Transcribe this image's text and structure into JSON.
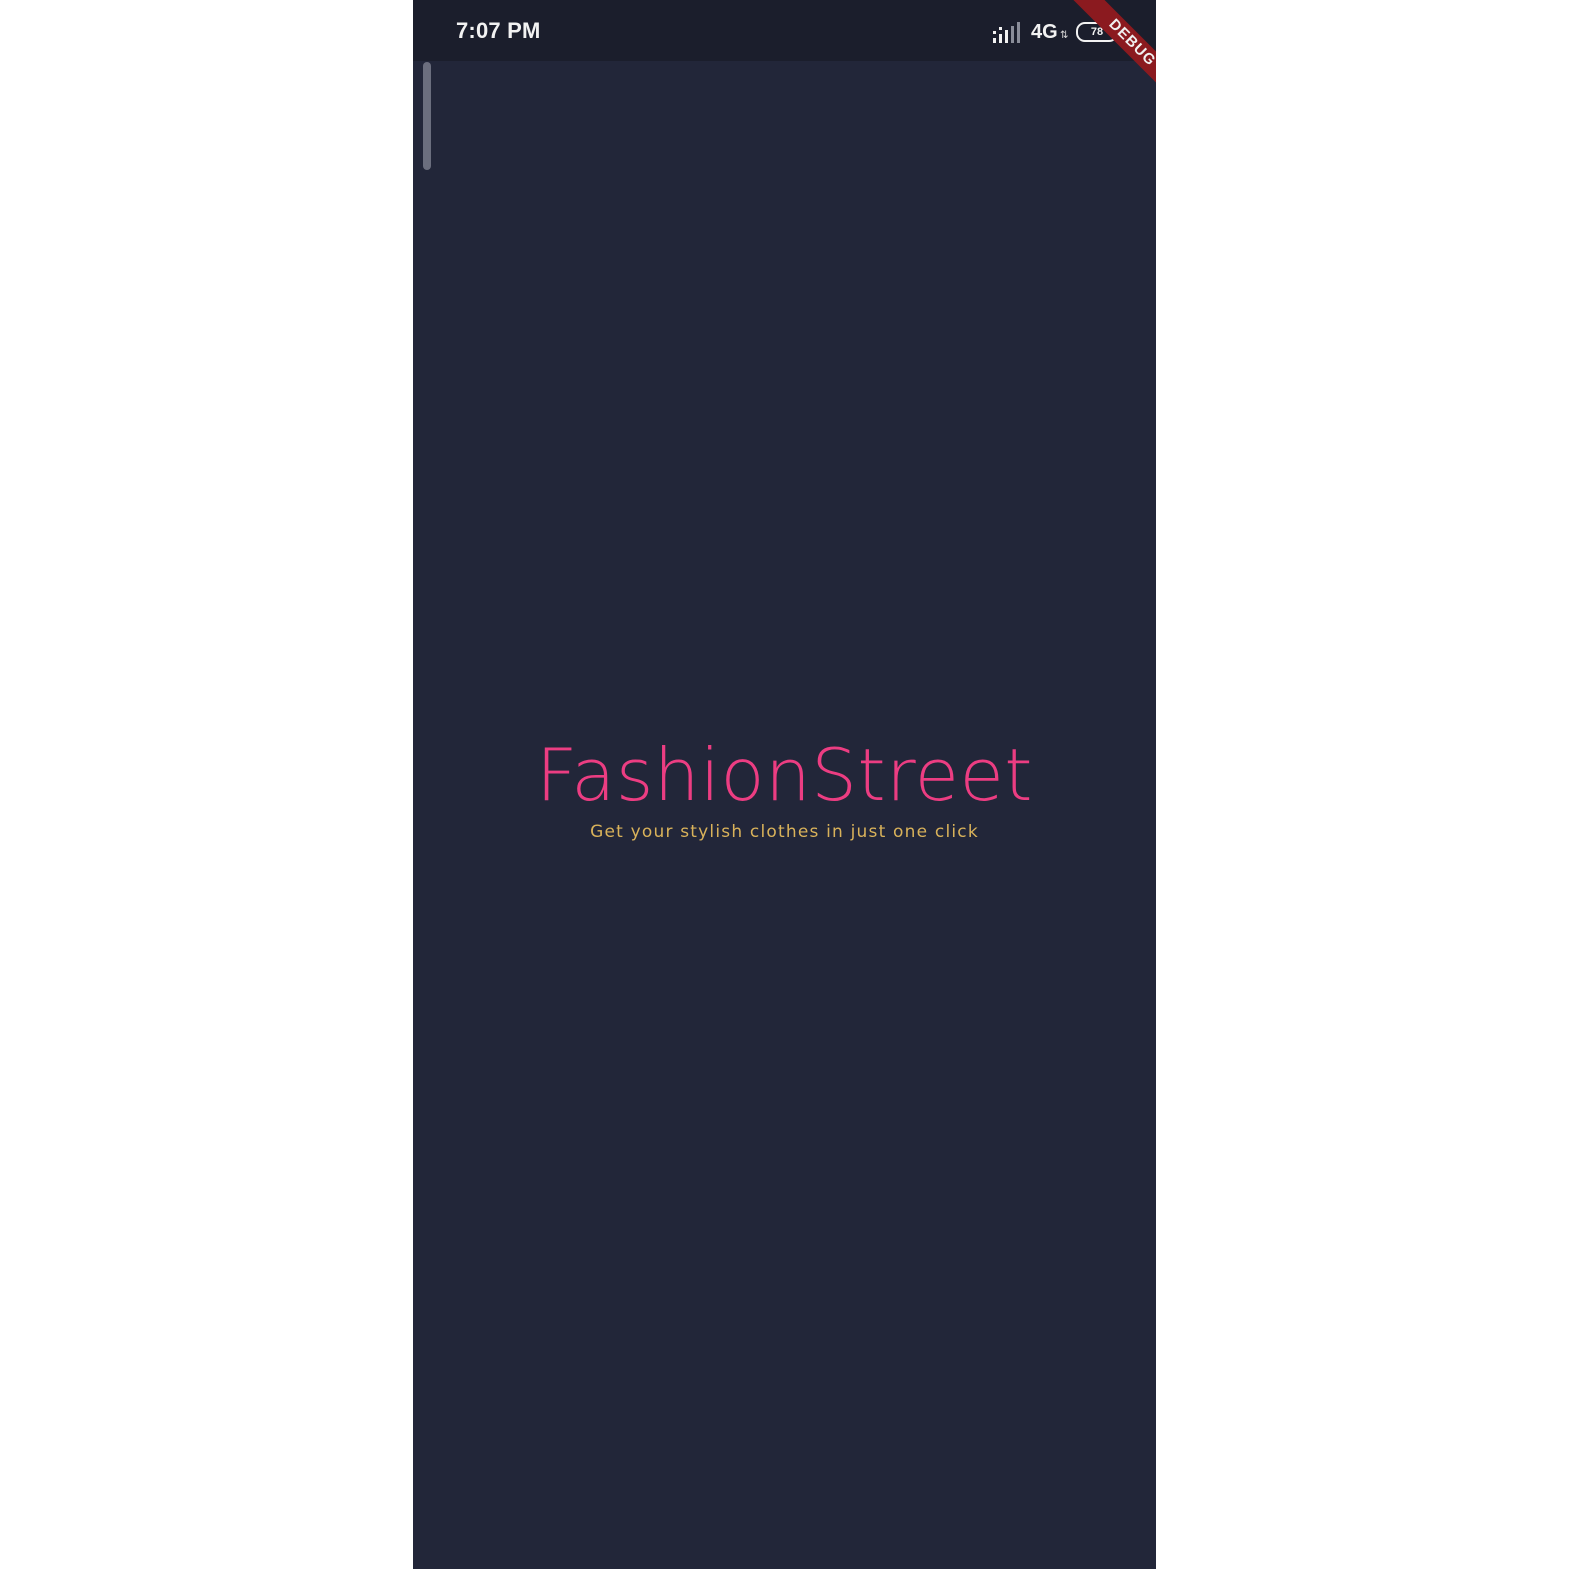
{
  "status_bar": {
    "time": "7:07 PM",
    "network_type": "4G",
    "network_activity": "⇅",
    "battery_level": "78",
    "signal_icon": "signal-bars-icon",
    "battery_icon": "battery-icon"
  },
  "debug_banner": {
    "label": "DEBUG"
  },
  "splash": {
    "title": "FashionStreet",
    "tagline": "Get your stylish clothes in just one click"
  },
  "colors": {
    "background": "#222639",
    "status_bar": "#1b1e2c",
    "title": "#ec3d82",
    "tagline": "#d9b25a",
    "debug_banner": "#8b1a1f"
  }
}
